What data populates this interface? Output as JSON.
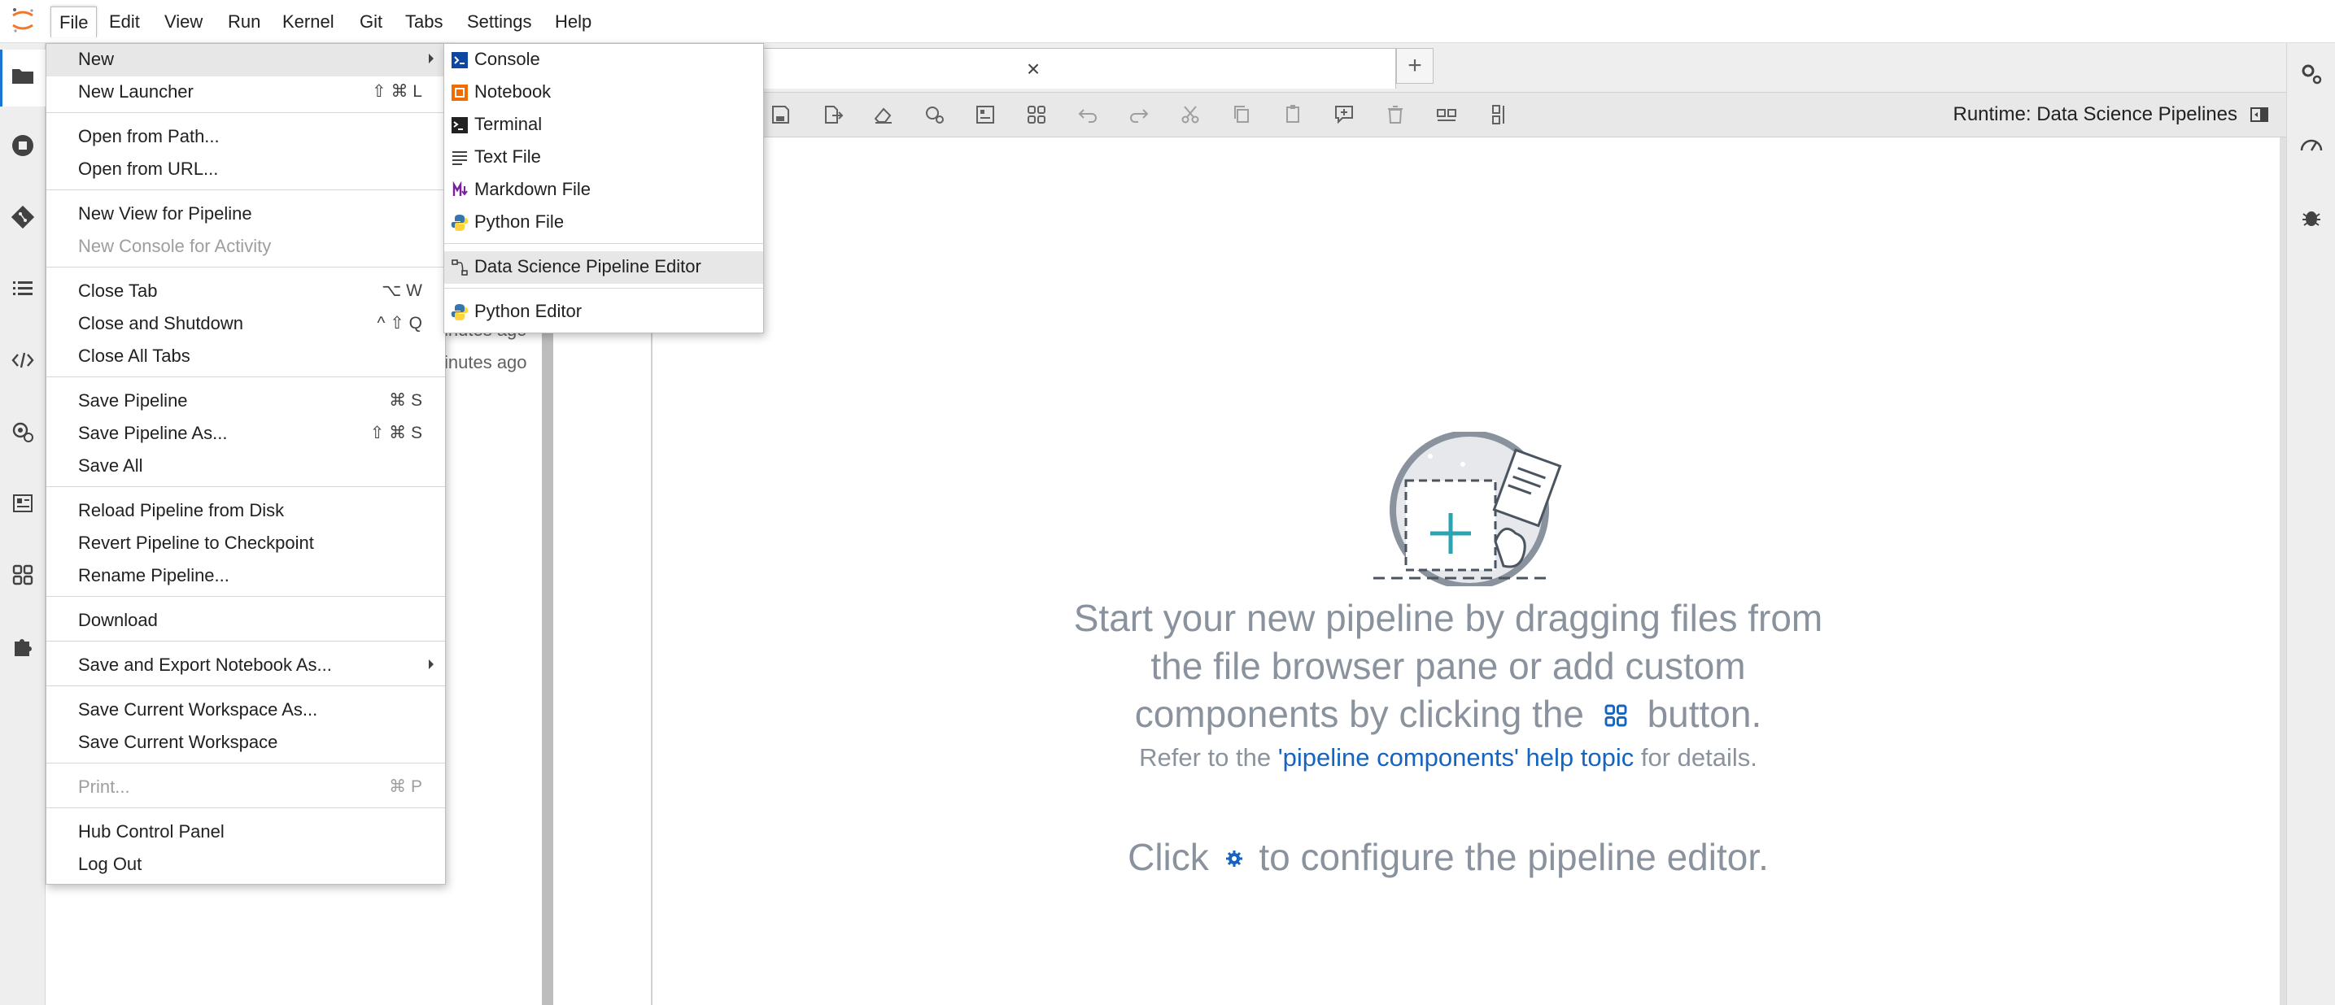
{
  "menubar": {
    "items": [
      "File",
      "Edit",
      "View",
      "Run",
      "Kernel",
      "Git",
      "Tabs",
      "Settings",
      "Help"
    ]
  },
  "file_menu": {
    "items": [
      {
        "label": "New",
        "shortcut": "",
        "submenu": true,
        "disabled": false
      },
      {
        "label": "New Launcher",
        "shortcut": "⇧ ⌘ L",
        "disabled": false
      },
      {
        "label": "Open from Path...",
        "shortcut": "",
        "disabled": false
      },
      {
        "label": "Open from URL...",
        "shortcut": "",
        "disabled": false
      },
      {
        "label": "New View for Pipeline",
        "shortcut": "",
        "disabled": false
      },
      {
        "label": "New Console for Activity",
        "shortcut": "",
        "disabled": true
      },
      {
        "label": "Close Tab",
        "shortcut": "⌥ W",
        "disabled": false
      },
      {
        "label": "Close and Shutdown",
        "shortcut": "^ ⇧ Q",
        "disabled": false
      },
      {
        "label": "Close All Tabs",
        "shortcut": "",
        "disabled": false
      },
      {
        "label": "Save Pipeline",
        "shortcut": "⌘ S",
        "disabled": false
      },
      {
        "label": "Save Pipeline As...",
        "shortcut": "⇧ ⌘ S",
        "disabled": false
      },
      {
        "label": "Save All",
        "shortcut": "",
        "disabled": false
      },
      {
        "label": "Reload Pipeline from Disk",
        "shortcut": "",
        "disabled": false
      },
      {
        "label": "Revert Pipeline to Checkpoint",
        "shortcut": "",
        "disabled": false
      },
      {
        "label": "Rename Pipeline...",
        "shortcut": "",
        "disabled": false
      },
      {
        "label": "Download",
        "shortcut": "",
        "disabled": false
      },
      {
        "label": "Save and Export Notebook As...",
        "shortcut": "",
        "submenu": true,
        "disabled": false
      },
      {
        "label": "Save Current Workspace As...",
        "shortcut": "",
        "disabled": false
      },
      {
        "label": "Save Current Workspace",
        "shortcut": "",
        "disabled": false
      },
      {
        "label": "Print...",
        "shortcut": "⌘ P",
        "disabled": true
      },
      {
        "label": "Hub Control Panel",
        "shortcut": "",
        "disabled": false
      },
      {
        "label": "Log Out",
        "shortcut": "",
        "disabled": false
      }
    ]
  },
  "new_menu": {
    "items": [
      {
        "label": "Console",
        "icon": "console-icon"
      },
      {
        "label": "Notebook",
        "icon": "notebook-icon"
      },
      {
        "label": "Terminal",
        "icon": "terminal-icon"
      },
      {
        "label": "Text File",
        "icon": "text-file-icon"
      },
      {
        "label": "Markdown File",
        "icon": "markdown-icon"
      },
      {
        "label": "Python File",
        "icon": "python-icon"
      },
      {
        "label": "Data Science Pipeline Editor",
        "icon": "pipeline-icon"
      },
      {
        "label": "Python Editor",
        "icon": "python-icon"
      }
    ]
  },
  "file_browser": {
    "times": [
      "inutes ago",
      "inutes ago"
    ]
  },
  "tab": {
    "close": "×",
    "add": "+"
  },
  "toolbar": {
    "runtime_label": "Runtime: Data Science Pipelines"
  },
  "empty_state": {
    "line1": "Start your new pipeline by dragging files from",
    "line2": "the file browser pane or add custom",
    "line3_pre": "components by clicking the",
    "line3_post": "button.",
    "line4_pre": "Refer to the",
    "line4_link": "'pipeline components' help topic",
    "line4_post": "for details.",
    "line5_pre": "Click",
    "line5_post": "to configure the pipeline editor."
  },
  "colors": {
    "accent": "#1565c0",
    "menu_highlight": "#e7e7e7",
    "empty_text": "#8a939d",
    "logo_orange": "#f37726"
  }
}
